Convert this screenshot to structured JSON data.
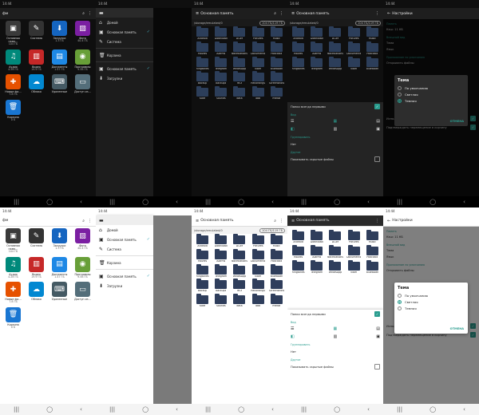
{
  "status": {
    "time": "14:44"
  },
  "nav": {
    "recents": "|||",
    "home": "◯",
    "back": "‹"
  },
  "home": {
    "title": "фм",
    "apps": [
      {
        "name": "Основная памя…",
        "info": "104 ГБ",
        "icon": "sd-icon",
        "color": "#3a3a3a"
      },
      {
        "name": "Система",
        "info": "",
        "icon": "pen-icon",
        "color": "#333"
      },
      {
        "name": "Загрузки",
        "info": "1.3 ГБ",
        "icon": "download-icon",
        "color": "#1565c0"
      },
      {
        "name": "Фото",
        "info": "40.4 ГБ",
        "icon": "photo-icon",
        "color": "#7b1fa2"
      },
      {
        "name": "Аудио",
        "info": "4.28 ГБ",
        "icon": "music-icon",
        "color": "#00897b"
      },
      {
        "name": "Видео",
        "info": "19.9 ГБ",
        "icon": "film-icon",
        "color": "#c62828"
      },
      {
        "name": "Документы",
        "info": "1.47 ГБ",
        "icon": "doc-icon",
        "color": "#1e88e5"
      },
      {
        "name": "Программы",
        "info": "9.58 ГБ",
        "icon": "android-icon",
        "color": "#689f38"
      },
      {
        "name": "Новые фа…",
        "info": "7.8 ГБ",
        "icon": "new-icon",
        "color": "#e65100"
      },
      {
        "name": "Облако",
        "info": "",
        "icon": "cloud-icon",
        "color": "#0288d1"
      },
      {
        "name": "Удаленные",
        "info": "",
        "icon": "remote-icon",
        "color": "#455a64"
      },
      {
        "name": "Доступ из…",
        "info": "",
        "icon": "monitor-icon",
        "color": "#546e7a"
      },
      {
        "name": "Корзина",
        "info": "0 Б",
        "icon": "trash-icon",
        "color": "#1976d2"
      }
    ]
  },
  "drawer": {
    "items": [
      {
        "label": "Домой",
        "icon": "home-icon"
      },
      {
        "label": "Основная память",
        "icon": "sd-icon"
      },
      {
        "label": "Система",
        "icon": "pen-icon"
      },
      {
        "label": "Корзина",
        "icon": "trash-icon"
      },
      {
        "label": "Основная память",
        "icon": "sd-icon"
      },
      {
        "label": "Загрузки",
        "icon": "download-icon"
      }
    ]
  },
  "files": {
    "title": "Основная память",
    "path": "/storage/emulated/0",
    "free": "104 ГБ/119 ГБ",
    "items": [
      "Android",
      "Download",
      "DCIM",
      "Pictures",
      "Music",
      "Movies",
      "Alarms",
      "Notifications",
      "Documents",
      "Podcasts",
      "Ringtones",
      "Telegram",
      "WhatsApp",
      "Viber",
      "Bluetooth",
      "Backup",
      "backups",
      "MIUI",
      "Recordings",
      "Screenshots",
      "Kate",
      "Sounds",
      "data",
      "obb",
      "media"
    ]
  },
  "sheet": {
    "show_folders_first": "Папки всегда первыми",
    "view_caption": "Вид",
    "grouping_caption": "Группировать",
    "grouping_value": "Нет",
    "hidden_caption": "Другое",
    "show_hidden": "Показывать скрытые файлы"
  },
  "settings": {
    "title": "Настройки",
    "storage_caption": "Память",
    "storage_row": "Кэш: 11 КБ",
    "theme_caption": "Внешний вид",
    "theme_row": "Тема",
    "lang_row": "Язык",
    "default_caption": "Приложение по умолчанию",
    "default_row": "Открывать файлы",
    "dialog_title": "Тема",
    "options": [
      "По умолчанию",
      "Светлая",
      "Темная"
    ],
    "cancel": "ОТМЕНА",
    "bottom_rows": [
      "Использовать «Корзину» при удалении",
      "Подтверждать перемещение в корзину"
    ]
  }
}
